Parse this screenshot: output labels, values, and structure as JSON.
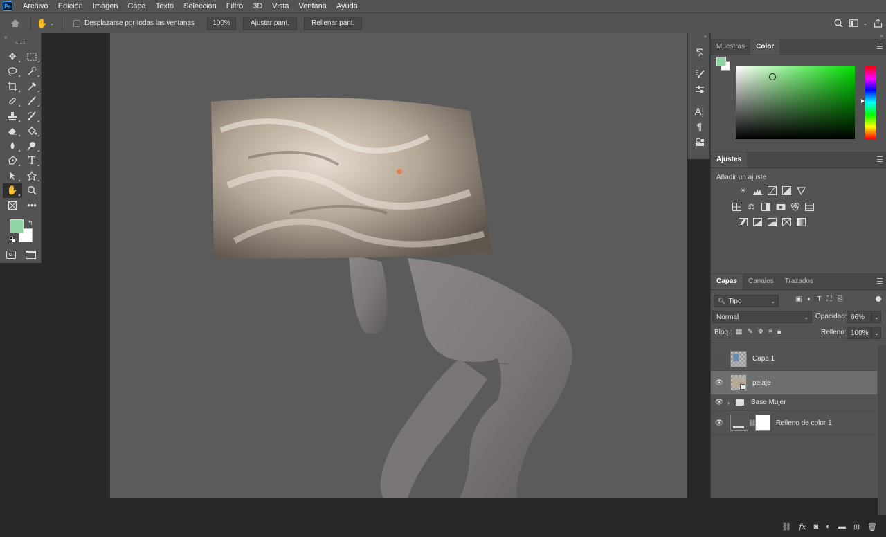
{
  "menubar": {
    "items": [
      "Archivo",
      "Edición",
      "Imagen",
      "Capa",
      "Texto",
      "Selección",
      "Filtro",
      "3D",
      "Vista",
      "Ventana",
      "Ayuda"
    ]
  },
  "options_bar": {
    "scroll_all_label": "Desplazarse por todas las ventanas",
    "zoom_value": "100%",
    "fit_screen_label": "Ajustar pant.",
    "fill_screen_label": "Rellenar pant."
  },
  "colors": {
    "foreground": "#8fd6a4",
    "background": "#ffffff",
    "ui_panel": "#535353",
    "canvas": "#5b5b5b"
  },
  "color_panel": {
    "tabs": [
      "Muestras",
      "Color"
    ],
    "active_tab": "Color"
  },
  "adjustments_panel": {
    "title": "Ajustes",
    "subtitle": "Añadir un ajuste",
    "rows": [
      [
        "brightness-contrast-icon",
        "levels-icon",
        "curves-icon",
        "exposure-icon",
        "vibrance-icon"
      ],
      [
        "hue-saturation-icon",
        "color-balance-icon",
        "black-white-icon",
        "photo-filter-icon",
        "channel-mixer-icon",
        "color-lookup-icon"
      ],
      [
        "invert-icon",
        "posterize-icon",
        "threshold-icon",
        "selective-color-icon",
        "gradient-map-icon"
      ]
    ]
  },
  "layers_panel": {
    "tabs": [
      "Capas",
      "Canales",
      "Trazados"
    ],
    "active_tab": "Capas",
    "filter_kind": "Tipo",
    "blend_mode": "Normal",
    "opacity_label": "Opacidad:",
    "opacity_value": "66%",
    "lock_label": "Bloq.:",
    "fill_label": "Relleno:",
    "fill_value": "100%",
    "layers": [
      {
        "name": "Capa 1",
        "visible": false,
        "selected": false
      },
      {
        "name": "pelaje",
        "visible": true,
        "selected": true
      },
      {
        "name": "Base Mujer",
        "visible": true,
        "selected": false,
        "group": true
      },
      {
        "name": "Relleno de color 1",
        "visible": true,
        "selected": false
      }
    ]
  }
}
